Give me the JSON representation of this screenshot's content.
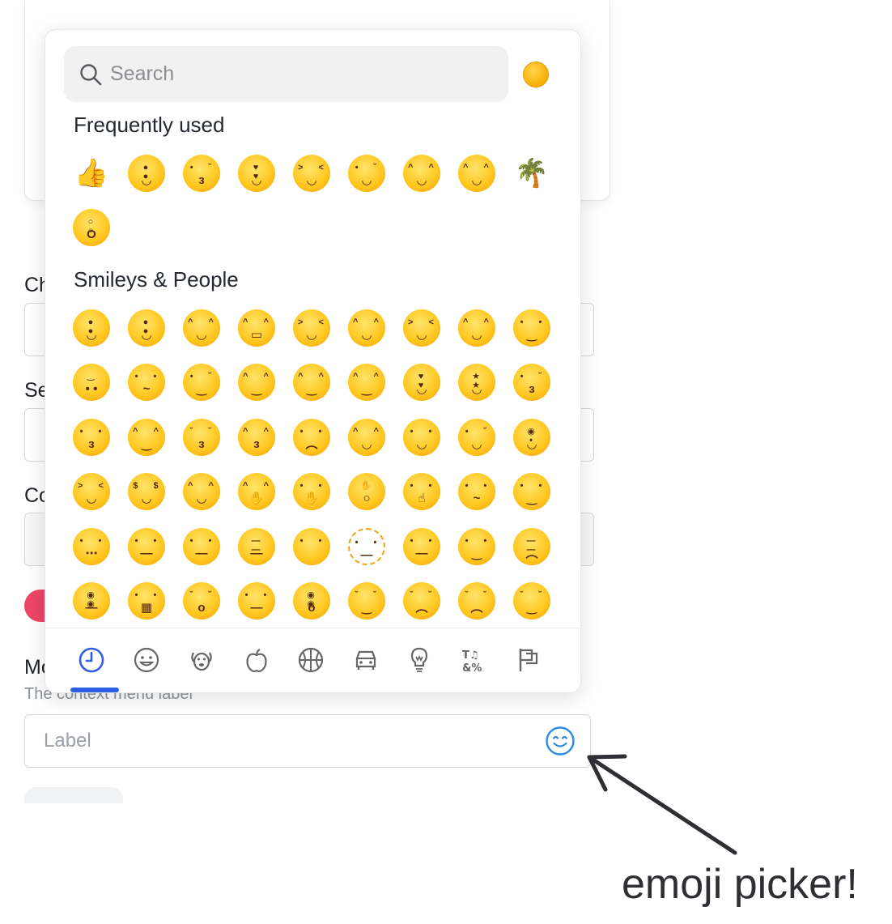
{
  "form": {
    "labels": [
      "Ch",
      "Se",
      "Co",
      "Mo"
    ],
    "hint": "The context menu label",
    "label_placeholder": "Label"
  },
  "picker": {
    "search_placeholder": "Search",
    "skin_tone": "default-yellow",
    "sections": [
      {
        "title": "Frequently used",
        "emojis": [
          "thumbs-up",
          "grinning",
          "kissing-heart",
          "heart-eyes",
          "laughing",
          "winking-tongue",
          "sweat-smile",
          "joy",
          "palm-tree",
          "scream"
        ]
      },
      {
        "title": "Smileys & People",
        "emojis": [
          "grinning",
          "smiley",
          "smile",
          "grin",
          "laughing",
          "sweat-smile",
          "rofl",
          "joy",
          "slightly-smiling",
          "upside-down",
          "melting",
          "wink",
          "blush",
          "innocent",
          "smiling-hearts",
          "heart-eyes",
          "star-struck",
          "kissing-heart",
          "kissing",
          "relaxed",
          "kissing-closed-eyes",
          "kissing-smiling-eyes",
          "holding-back-tears",
          "yum",
          "tongue",
          "winking-tongue",
          "zany",
          "squinting-tongue",
          "money-mouth",
          "hugging",
          "hand-over-mouth",
          "open-eyes-hand-over-mouth",
          "peeking-eye",
          "shushing",
          "thinking",
          "saluting",
          "zipper-mouth",
          "raised-eyebrow",
          "neutral",
          "expressionless",
          "no-mouth",
          "dotted-line-face",
          "face-in-clouds",
          "smirk",
          "unamused",
          "eye-roll",
          "grimacing",
          "exhaling",
          "lying",
          "shaking",
          "relieved",
          "pensive",
          "sleepy",
          "drooling"
        ]
      }
    ],
    "tabs": [
      "recent",
      "smileys",
      "animals",
      "food",
      "activity",
      "travel",
      "objects",
      "symbols",
      "flags"
    ],
    "active_tab": "recent"
  },
  "annotation": "emoji picker!"
}
